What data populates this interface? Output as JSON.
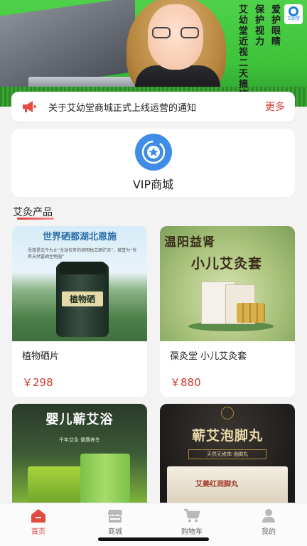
{
  "banner": {
    "slogan_columns": [
      "爱护眼睛",
      "保护视力",
      "艾幼堂近视二天摘镜"
    ],
    "brand_label": "艾幼堂"
  },
  "notice": {
    "icon": "megaphone-icon",
    "text": "关于艾幼堂商城正式上线运营的通知",
    "more_label": "更多"
  },
  "vip": {
    "icon": "vip-star-icon",
    "label": "VIP商城"
  },
  "section": {
    "title": "艾灸产品"
  },
  "products": [
    {
      "name": "植物硒片",
      "price": "￥298",
      "image_text": {
        "headline": "世界硒都湖北恩施",
        "subtext": "恩施是迄今为止“全球仅有的探明独立硒矿床”，被誉为“世界天然富硒生物圈”",
        "label": "植物硒"
      }
    },
    {
      "name": "葆灸堂 小儿艾灸套",
      "price": "￥880",
      "image_text": {
        "line1": "温阳益肾",
        "line2": "小儿艾灸套"
      }
    },
    {
      "name": "",
      "price": "",
      "image_text": {
        "line1": "婴儿蕲艾浴",
        "line2": "千年艾灸  健康养生"
      }
    },
    {
      "name": "",
      "price": "",
      "image_text": {
        "line1": "蕲艾泡脚丸",
        "line2": "天然无修饰·泡脚丸",
        "box_text": "艾姜红润脚丸"
      }
    }
  ],
  "tabbar": [
    {
      "label": "首页",
      "icon": "home-icon",
      "active": true
    },
    {
      "label": "商城",
      "icon": "store-icon",
      "active": false
    },
    {
      "label": "购物车",
      "icon": "cart-icon",
      "active": false
    },
    {
      "label": "我的",
      "icon": "user-icon",
      "active": false
    }
  ],
  "colors": {
    "accent_red": "#d6382f",
    "vip_blue": "#3f8de6",
    "banner_green": "#4fd14a"
  }
}
